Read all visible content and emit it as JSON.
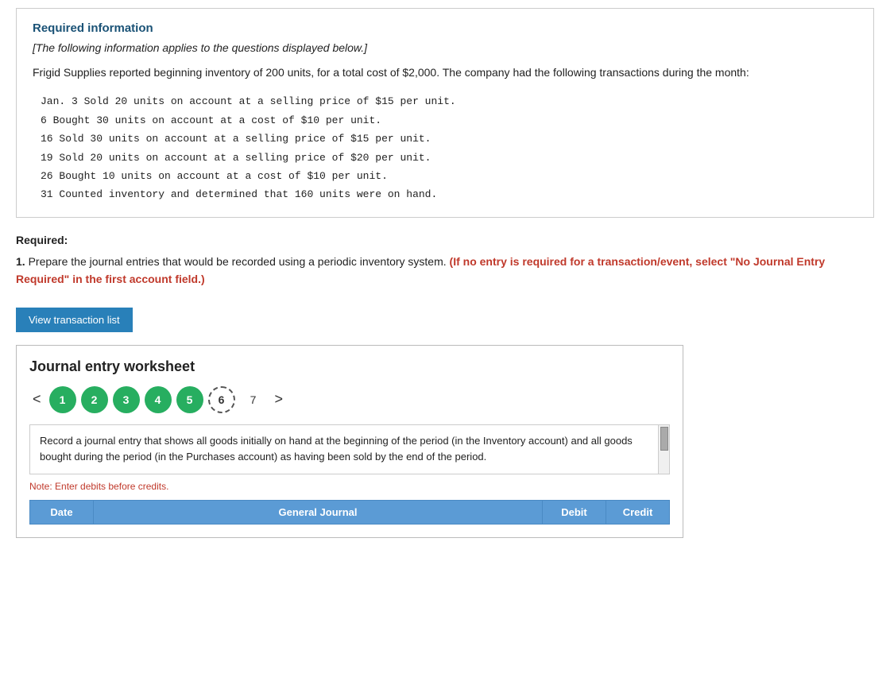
{
  "required_info": {
    "title": "Required information",
    "subtitle": "[The following information applies to the questions displayed below.]",
    "body": "Frigid Supplies reported beginning inventory of 200 units, for a total cost of $2,000. The company had the following transactions during the month:",
    "transactions": [
      "Jan.  3 Sold 20 units on account at a selling price of $15 per unit.",
      "      6 Bought 30 units on account at a cost of $10 per unit.",
      "     16 Sold 30 units on account at a selling price of $15 per unit.",
      "     19 Sold 20 units on account at a selling price of $20 per unit.",
      "     26 Bought 10 units on account at a cost of $10 per unit.",
      "     31 Counted inventory and determined that 160 units were on hand."
    ]
  },
  "required_label": "Required:",
  "question": {
    "number": "1.",
    "text_normal": "Prepare the journal entries that would be recorded using a periodic inventory system.",
    "text_bold": "(If no entry is required for a transaction/event, select \"No Journal Entry Required\" in the first account field.)"
  },
  "view_transaction_btn": "View transaction list",
  "journal_worksheet": {
    "title": "Journal entry worksheet",
    "tabs": {
      "arrow_left": "<",
      "arrow_right": ">",
      "circles": [
        "1",
        "2",
        "3",
        "4",
        "5"
      ],
      "active_tab": "6",
      "plain_tab": "7"
    },
    "description": "Record a journal entry that shows all goods initially on hand at the beginning of the period (in the Inventory account) and all goods bought during the period (in the Purchases account) as having been sold by the end of the period.",
    "note": "Note: Enter debits before credits.",
    "table": {
      "headers": [
        "Date",
        "General Journal",
        "Debit",
        "Credit"
      ]
    }
  }
}
